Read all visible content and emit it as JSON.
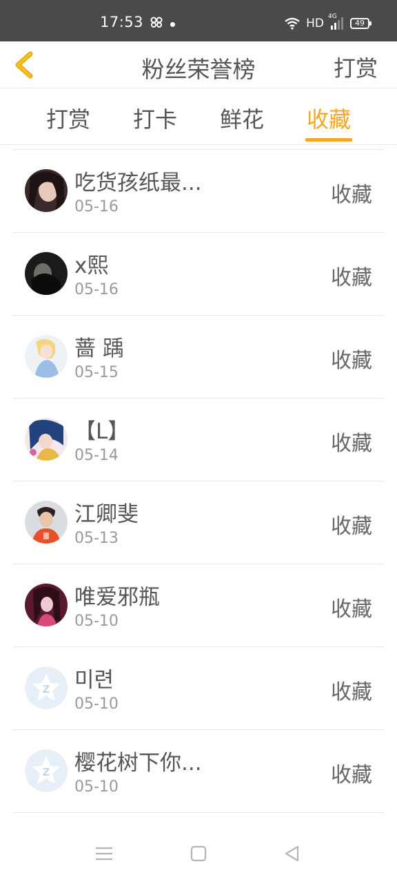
{
  "status_bar": {
    "time": "17:53",
    "network": "HD",
    "signal_label": "4G",
    "battery": "49"
  },
  "header": {
    "title": "粉丝荣誉榜",
    "right_action": "打赏"
  },
  "tabs": [
    {
      "label": "打赏",
      "active": false
    },
    {
      "label": "打卡",
      "active": false
    },
    {
      "label": "鲜花",
      "active": false
    },
    {
      "label": "收藏",
      "active": true
    }
  ],
  "accent_color": "#f5a623",
  "items": [
    {
      "name": "吃货孩纸最...",
      "date": "05-16",
      "action": "收藏",
      "avatar": "portrait-dark"
    },
    {
      "name": "x熙",
      "date": "05-16",
      "action": "收藏",
      "avatar": "portrait-black"
    },
    {
      "name": "蔷 踽",
      "date": "05-15",
      "action": "收藏",
      "avatar": "illustration-light"
    },
    {
      "name": "【L】",
      "date": "05-14",
      "action": "收藏",
      "avatar": "anime-blue"
    },
    {
      "name": "江卿斐",
      "date": "05-13",
      "action": "收藏",
      "avatar": "person-orange"
    },
    {
      "name": "唯爱邪瓶",
      "date": "05-10",
      "action": "收藏",
      "avatar": "portrait-pink"
    },
    {
      "name": "미련",
      "date": "05-10",
      "action": "收藏",
      "avatar": "default-star"
    },
    {
      "name": "樱花树下你...",
      "date": "05-10",
      "action": "收藏",
      "avatar": "default-star"
    }
  ]
}
